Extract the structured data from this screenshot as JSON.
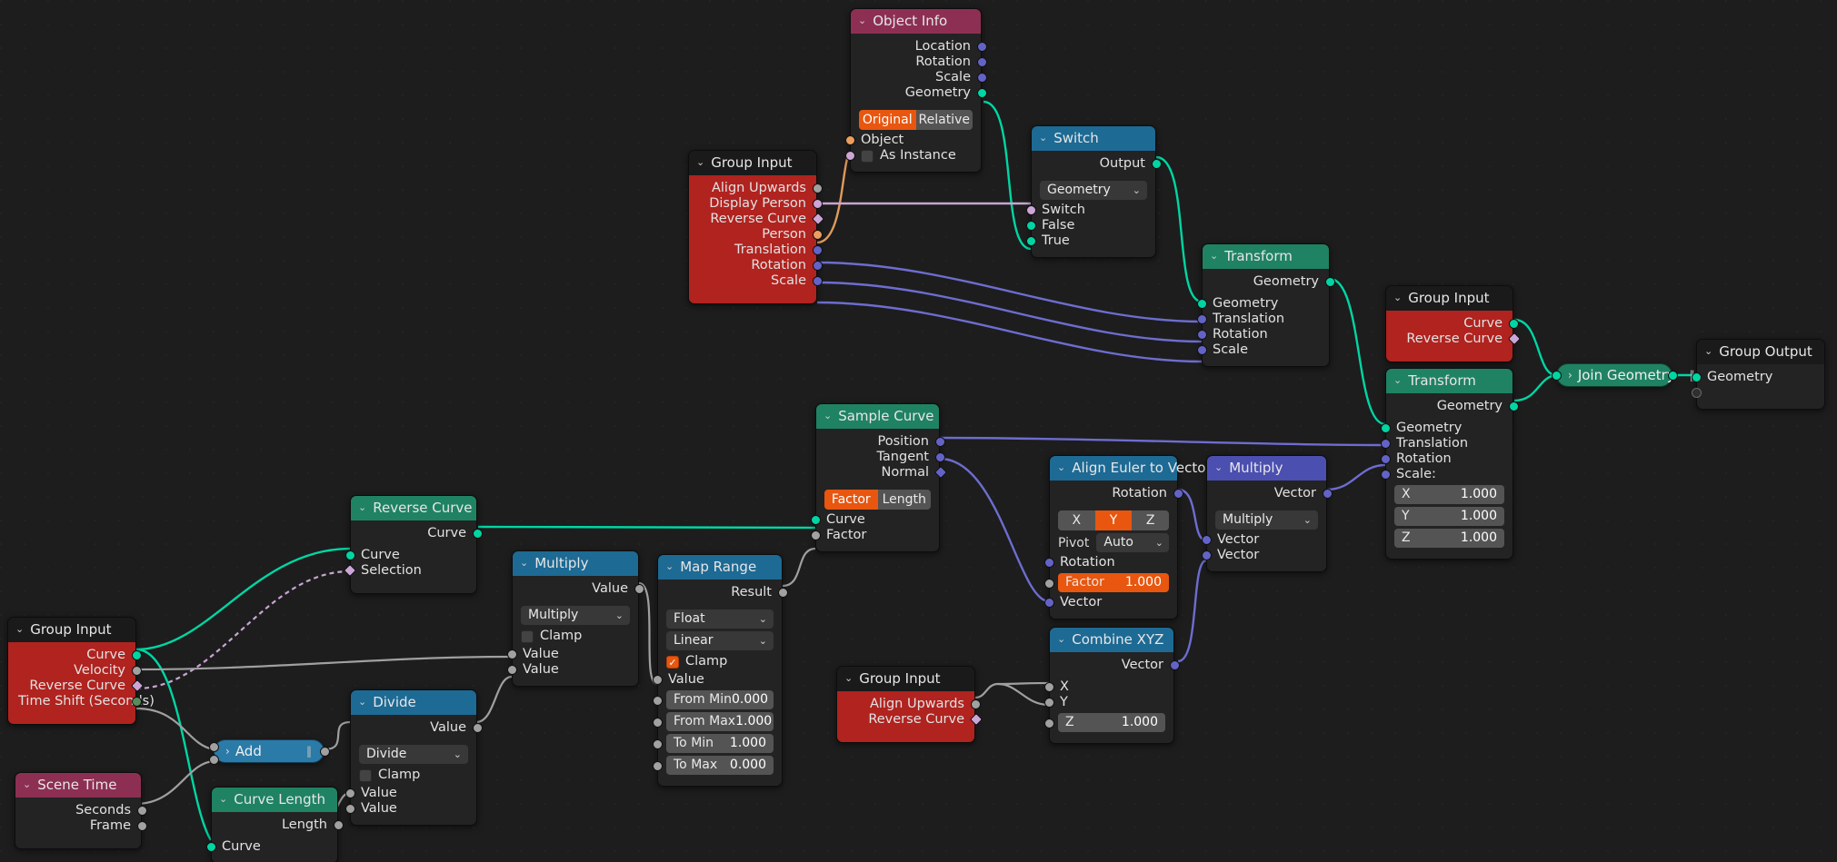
{
  "editor": {
    "name": "Blender Geometry Nodes Editor",
    "background": "#1d1d1d"
  },
  "colors": {
    "geometry_header": "#1f8263",
    "vector_header": "#4b4fb0",
    "converter_header": "#1d6a94",
    "input_header": "#8d2f53",
    "group_input_body": "#b0231f",
    "accent_orange": "#e8560f",
    "wire_geometry": "#00d6a3",
    "wire_vector": "#6d6dd0",
    "wire_float": "#a0a0a0",
    "wire_object": "#e09a5c",
    "wire_boolean": "#c9a5d4"
  },
  "nodes": [
    {
      "id": "object_info",
      "title": "Object Info",
      "outputs": [
        "Location",
        "Rotation",
        "Scale",
        "Geometry"
      ],
      "seg": {
        "options": [
          "Original",
          "Relative"
        ],
        "selected": "Original"
      },
      "inputs": [
        "Object",
        "As Instance"
      ]
    },
    {
      "id": "switch",
      "title": "Switch",
      "outputs": [
        "Output"
      ],
      "dropdown": "Geometry",
      "inputs": [
        "Switch",
        "False",
        "True"
      ]
    },
    {
      "id": "group_input_main",
      "title": "Group Input",
      "outputs": [
        "Align Upwards",
        "Display Person",
        "Reverse Curve",
        "Person",
        "Translation",
        "Rotation",
        "Scale"
      ]
    },
    {
      "id": "transform_1",
      "title": "Transform",
      "outputs": [
        "Geometry"
      ],
      "inputs": [
        "Geometry",
        "Translation",
        "Rotation",
        "Scale"
      ]
    },
    {
      "id": "group_input_curve",
      "title": "Group Input",
      "outputs": [
        "Curve",
        "Reverse Curve"
      ]
    },
    {
      "id": "transform_2",
      "title": "Transform",
      "outputs": [
        "Geometry"
      ],
      "inputs": [
        "Geometry",
        "Translation",
        "Rotation",
        "Scale:"
      ],
      "scale_fields": [
        {
          "label": "X",
          "value": "1.000"
        },
        {
          "label": "Y",
          "value": "1.000"
        },
        {
          "label": "Z",
          "value": "1.000"
        }
      ]
    },
    {
      "id": "join_geometry",
      "title": "Join Geometry",
      "collapsed": true
    },
    {
      "id": "group_output",
      "title": "Group Output",
      "inputs": [
        "Geometry"
      ]
    },
    {
      "id": "sample_curve",
      "title": "Sample Curve",
      "outputs": [
        "Position",
        "Tangent",
        "Normal"
      ],
      "seg": {
        "options": [
          "Factor",
          "Length"
        ],
        "selected": "Factor"
      },
      "inputs": [
        "Curve",
        "Factor"
      ]
    },
    {
      "id": "align_euler",
      "title": "Align Euler to Vector",
      "outputs": [
        "Rotation"
      ],
      "axis": {
        "options": [
          "X",
          "Y",
          "Z"
        ],
        "selected": "Y"
      },
      "pivot": {
        "label": "Pivot",
        "value": "Auto"
      },
      "inputs": [
        "Rotation",
        "Vector"
      ],
      "factor": {
        "label": "Factor",
        "value": "1.000"
      }
    },
    {
      "id": "multiply_vector",
      "title": "Multiply",
      "outputs": [
        "Vector"
      ],
      "dropdown": "Multiply",
      "inputs": [
        "Vector",
        "Vector"
      ]
    },
    {
      "id": "combine_xyz",
      "title": "Combine XYZ",
      "outputs": [
        "Vector"
      ],
      "inputs": [
        "X",
        "Y"
      ],
      "z_field": {
        "label": "Z",
        "value": "1.000"
      }
    },
    {
      "id": "group_input_align",
      "title": "Group Input",
      "outputs": [
        "Align Upwards",
        "Reverse Curve"
      ]
    },
    {
      "id": "map_range",
      "title": "Map Range",
      "outputs": [
        "Result"
      ],
      "dropdowns": [
        "Float",
        "Linear"
      ],
      "clamp": {
        "label": "Clamp",
        "checked": true
      },
      "inputs": [
        "Value"
      ],
      "fields": [
        {
          "label": "From Min",
          "value": "0.000"
        },
        {
          "label": "From Max",
          "value": "1.000"
        },
        {
          "label": "To Min",
          "value": "1.000"
        },
        {
          "label": "To Max",
          "value": "0.000"
        }
      ]
    },
    {
      "id": "multiply_float",
      "title": "Multiply",
      "outputs": [
        "Value"
      ],
      "dropdown": "Multiply",
      "clamp": {
        "label": "Clamp",
        "checked": false
      },
      "inputs": [
        "Value",
        "Value"
      ]
    },
    {
      "id": "divide",
      "title": "Divide",
      "outputs": [
        "Value"
      ],
      "dropdown": "Divide",
      "clamp": {
        "label": "Clamp",
        "checked": false
      },
      "inputs": [
        "Value",
        "Value"
      ]
    },
    {
      "id": "reverse_curve",
      "title": "Reverse Curve",
      "outputs": [
        "Curve"
      ],
      "inputs": [
        "Curve",
        "Selection"
      ]
    },
    {
      "id": "group_input_left",
      "title": "Group Input",
      "outputs": [
        "Curve",
        "Velocity",
        "Reverse Curve",
        "Time Shift (Seconds)"
      ]
    },
    {
      "id": "add",
      "title": "Add",
      "collapsed": true
    },
    {
      "id": "curve_length",
      "title": "Curve Length",
      "outputs": [
        "Length"
      ],
      "inputs": [
        "Curve"
      ]
    },
    {
      "id": "scene_time",
      "title": "Scene Time",
      "outputs": [
        "Seconds",
        "Frame"
      ]
    }
  ],
  "icons": {
    "collapse_chevron": "⌄",
    "expand_chevron": "›",
    "dropdown_chevron": "⌄",
    "check": "✓",
    "grip": "‖"
  }
}
